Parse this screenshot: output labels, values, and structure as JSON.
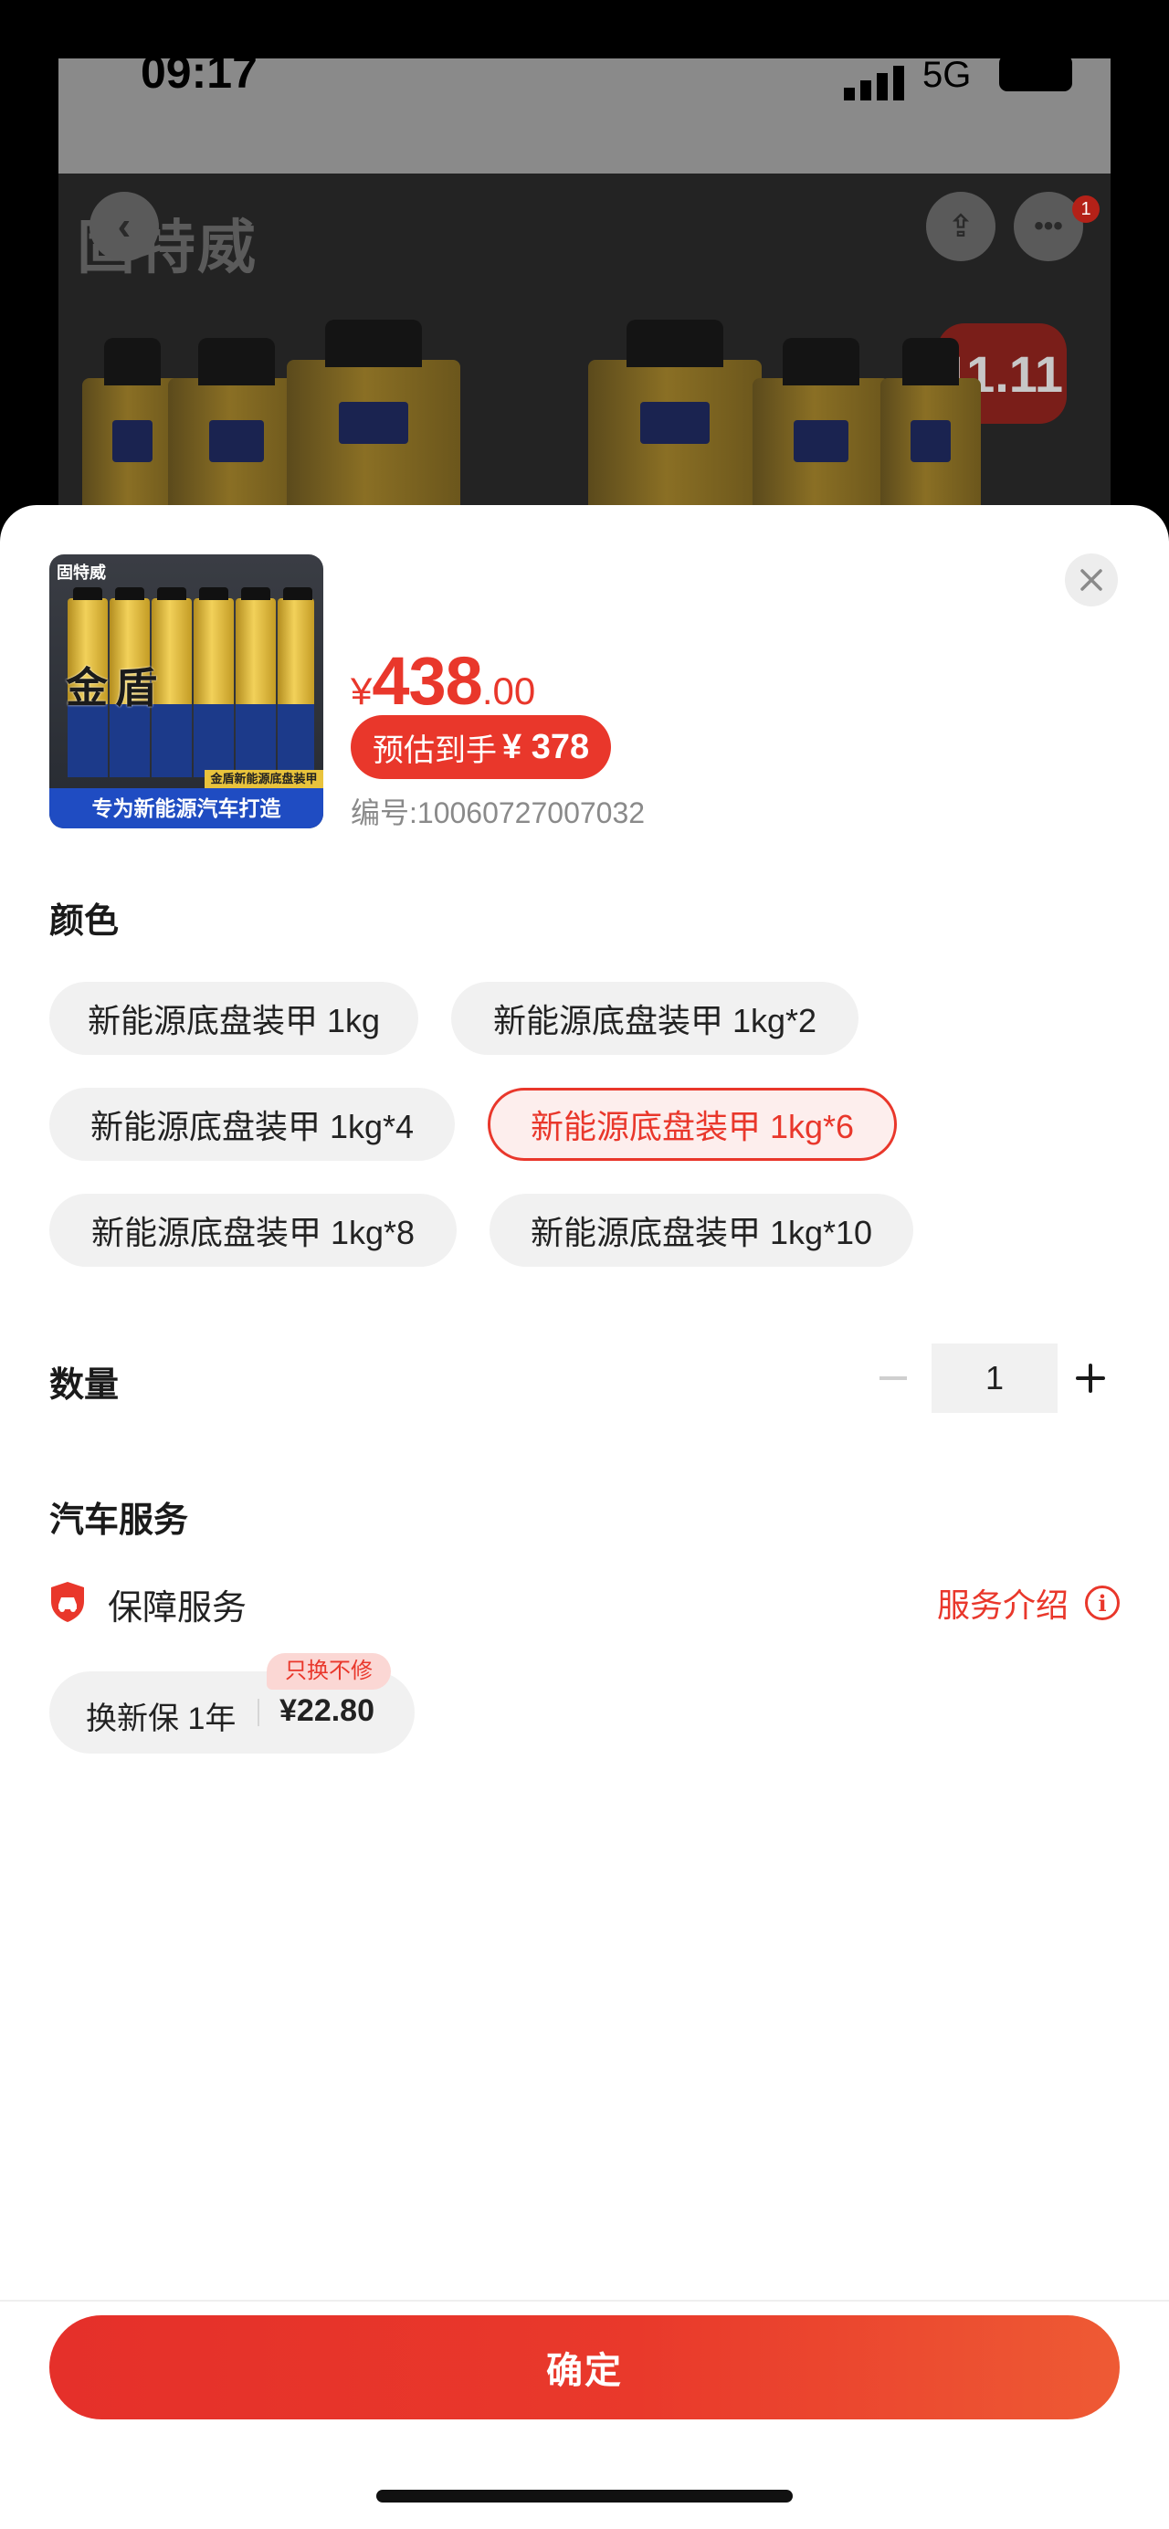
{
  "background": {
    "status": {
      "time": "09:17",
      "network": "5G"
    },
    "brand_text": "固特威",
    "notification_count": "1",
    "promo_badge": "11.11"
  },
  "sheet": {
    "product": {
      "thumb_brand": "固特威",
      "thumb_title": "金盾",
      "thumb_strip": "金盾新能源底盘装甲",
      "thumb_banner": "专为新能源汽车打造"
    },
    "price": {
      "currency": "¥",
      "integer": "438",
      "decimal": ".00"
    },
    "estimate": {
      "label": "预估到手",
      "amount": "¥ 378"
    },
    "sku_code": "编号:10060727007032",
    "color_section": {
      "title": "颜色",
      "options": [
        "新能源底盘装甲 1kg",
        "新能源底盘装甲 1kg*2",
        "新能源底盘装甲 1kg*4",
        "新能源底盘装甲 1kg*6",
        "新能源底盘装甲 1kg*8",
        "新能源底盘装甲 1kg*10"
      ],
      "selected": "新能源底盘装甲 1kg*6"
    },
    "quantity": {
      "title": "数量",
      "value": "1"
    },
    "car_service": {
      "title": "汽车服务",
      "protection_label": "保障服务",
      "intro_label": "服务介绍",
      "option": {
        "name": "换新保 1年",
        "price": "¥22.80",
        "tag": "只换不修"
      }
    },
    "confirm_label": "确定"
  },
  "colors": {
    "accent": "#e9372b",
    "chip_bg": "#f1f1f1",
    "selected_bg": "#fdeeed"
  }
}
